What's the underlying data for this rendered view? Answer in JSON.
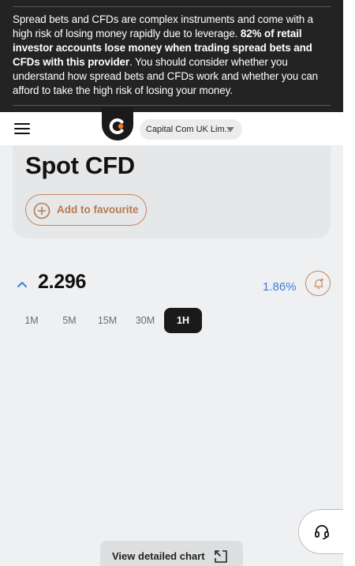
{
  "risk_warning": {
    "part1": "Spread bets and CFDs are complex instruments and come with a high risk of losing money rapidly due to leverage. ",
    "bold": "82% of retail investor accounts lose money when trading spread bets and CFDs with this provider",
    "part2": ". You should consider whether you understand how spread bets and CFDs work and whether you can afford to take the high risk of losing your money."
  },
  "header": {
    "entity_select_value": "Capital Com UK Lim...",
    "logo_icon": "capital-com-logo-icon",
    "menu_icon": "hamburger-menu-icon"
  },
  "instrument": {
    "title": "Spot CFD",
    "favourite_label": "Add to favourite"
  },
  "price": {
    "value": "2.296",
    "change": "1.86%",
    "direction_icon": "chevron-up-icon",
    "alert_icon": "bell-plus-icon"
  },
  "timeframes": [
    "1M",
    "5M",
    "15M",
    "30M",
    "1H"
  ],
  "active_timeframe": "1H",
  "chart": {
    "detailed_label": "View detailed chart",
    "expand_icon": "expand-icon"
  },
  "support": {
    "icon": "headset-icon"
  },
  "colors": {
    "accent": "#c8865a",
    "positive": "#3f7fd9",
    "banner_bg": "#232323",
    "panel_bg": "#eff0f2"
  }
}
